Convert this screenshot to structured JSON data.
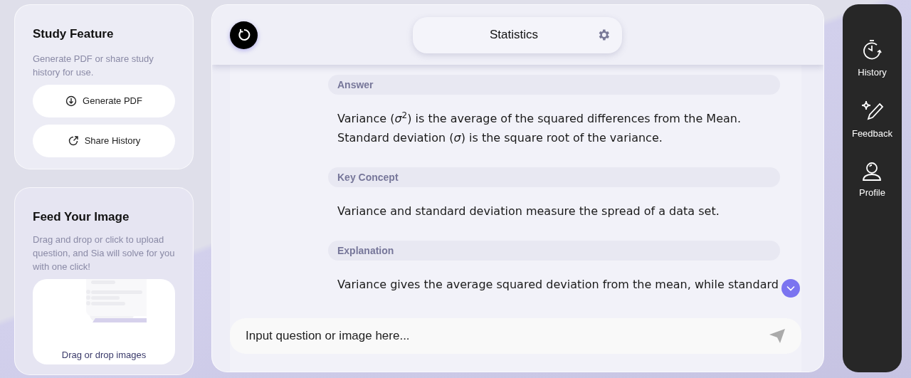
{
  "study_feature": {
    "title": "Study Feature",
    "description": "Generate PDF or share study history for use.",
    "buttons": [
      {
        "kind": "download",
        "label": "Generate PDF"
      },
      {
        "kind": "share",
        "label": "Share History"
      }
    ]
  },
  "feed_image": {
    "title": "Feed Your Image",
    "description": "Drag and drop or click to upload question, and Sia will solve for you with one click!",
    "drop_label": "Drag or drop images"
  },
  "header": {
    "subject": "Statistics"
  },
  "sections": [
    {
      "heading": "Answer",
      "lines": [
        "Variance (*σ*$^{2}$) is the average of the squared differences from the Mean.",
        "Standard deviation (*σ*) is the square root of the variance."
      ]
    },
    {
      "heading": "Key Concept",
      "lines": [
        "Variance and standard deviation measure the spread of a data set."
      ]
    },
    {
      "heading": "Explanation",
      "lines": [
        "Variance gives the average squared deviation from the mean, while standard"
      ]
    }
  ],
  "input": {
    "placeholder": "Input question or image here..."
  },
  "sidebar": [
    {
      "kind": "history",
      "label": "History"
    },
    {
      "kind": "feedback",
      "label": "Feedback"
    },
    {
      "kind": "profile",
      "label": "Profile"
    }
  ]
}
